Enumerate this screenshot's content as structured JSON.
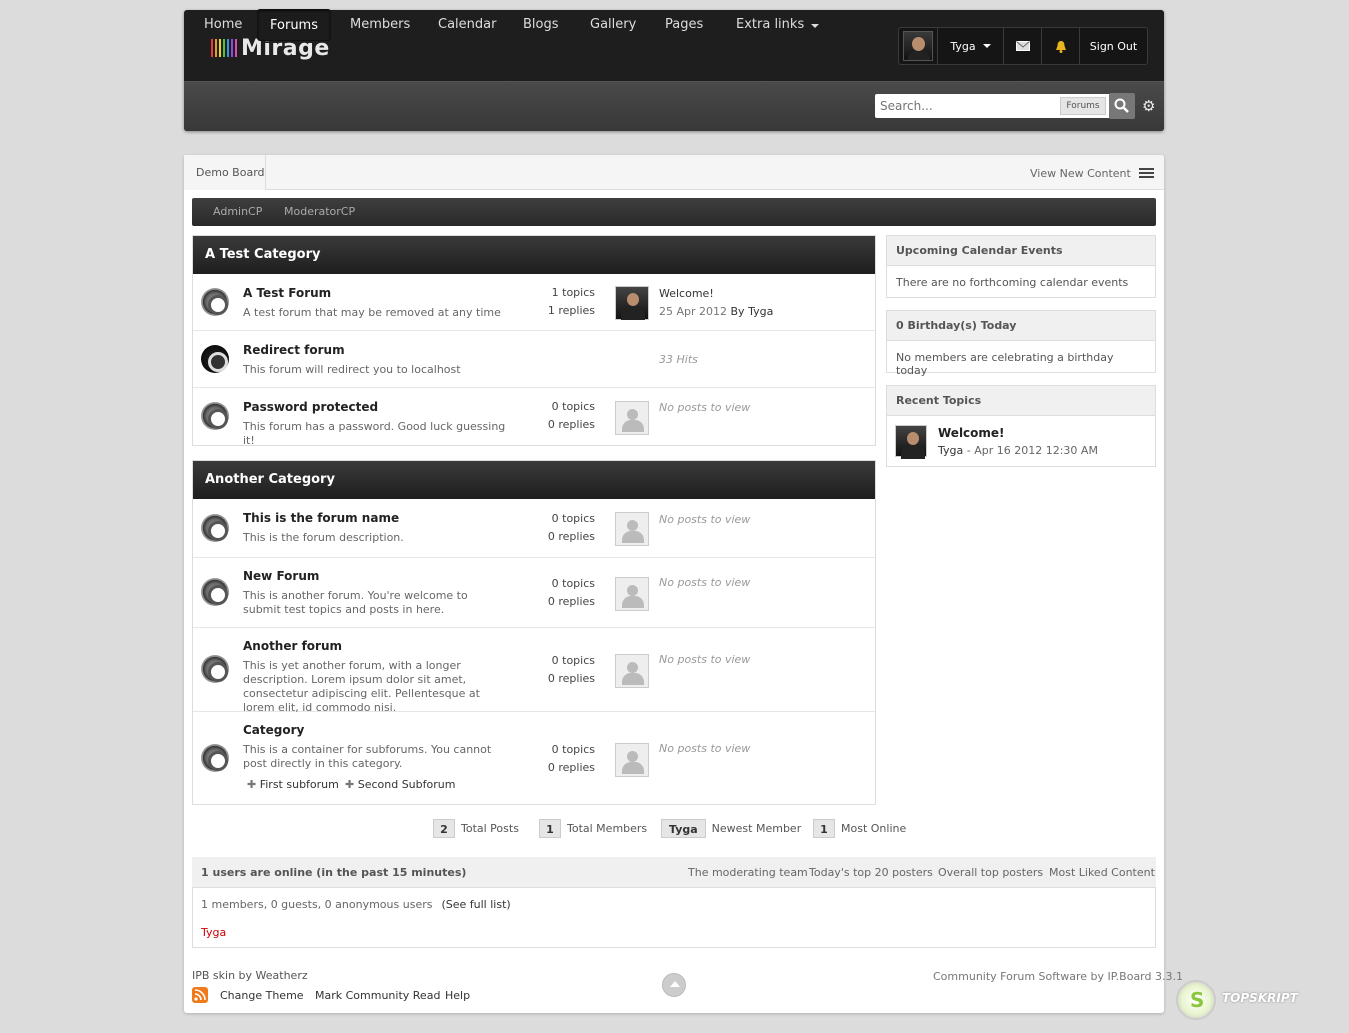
{
  "header": {
    "logo": "Mirage",
    "logo_bar_colors": [
      "#e63b3b",
      "#e89b2b",
      "#e6d82c",
      "#5fbf3a",
      "#3a8fe0",
      "#8a4fd6",
      "#d64fb3"
    ],
    "user_name": "Tyga",
    "sign_out": "Sign Out"
  },
  "nav": {
    "items": [
      "Home",
      "Forums",
      "Members",
      "Calendar",
      "Blogs",
      "Gallery",
      "Pages",
      "Extra links"
    ],
    "active": "Forums",
    "search_placeholder": "Search...",
    "search_scope": "Forums"
  },
  "breadcrumb": {
    "root": "Demo Board",
    "view_new": "View New Content"
  },
  "modbar": {
    "links": [
      "AdminCP",
      "ModeratorCP"
    ]
  },
  "categories": [
    {
      "name": "A Test Category",
      "forums": [
        {
          "title": "A Test Forum",
          "desc": "A test forum that may be removed at any time",
          "topics": "1 topics",
          "replies": "1 replies",
          "last_title": "Welcome!",
          "last_date": "25 Apr 2012",
          "last_by": "By",
          "last_user": "Tyga"
        },
        {
          "title": "Redirect forum",
          "desc": "This forum will redirect you to localhost",
          "hits": "33 Hits"
        },
        {
          "title": "Password protected",
          "desc": "This forum has a password. Good luck guessing it!",
          "topics": "0 topics",
          "replies": "0 replies",
          "no_posts": "No posts to view"
        }
      ]
    },
    {
      "name": "Another Category",
      "forums": [
        {
          "title": "This is the forum name",
          "desc": "This is the forum description.",
          "topics": "0 topics",
          "replies": "0 replies",
          "no_posts": "No posts to view"
        },
        {
          "title": "New Forum",
          "desc": "This is another forum. You're welcome to submit test topics and posts in here.",
          "topics": "0 topics",
          "replies": "0 replies",
          "no_posts": "No posts to view"
        },
        {
          "title": "Another forum",
          "desc": "This is yet another forum, with a longer description. Lorem ipsum dolor sit amet, consectetur adipiscing elit. Pellentesque at lorem elit, id commodo nisi.",
          "topics": "0 topics",
          "replies": "0 replies",
          "no_posts": "No posts to view"
        },
        {
          "title": "Category",
          "desc": "This is a container for subforums. You cannot post directly in this category.",
          "topics": "0 topics",
          "replies": "0 replies",
          "no_posts": "No posts to view",
          "subforums": [
            "First subforum",
            "Second Subforum"
          ]
        }
      ]
    }
  ],
  "sidebar": {
    "calendar": {
      "title": "Upcoming Calendar Events",
      "body": "There are no forthcoming calendar events"
    },
    "birthday": {
      "title": "0 Birthday(s) Today",
      "body": "No members are celebrating a birthday today"
    },
    "recent": {
      "title": "Recent Topics",
      "topic": "Welcome!",
      "user": "Tyga",
      "date": "- Apr 16 2012 12:30 AM"
    }
  },
  "stats": [
    {
      "value": "2",
      "label": "Total Posts"
    },
    {
      "value": "1",
      "label": "Total Members"
    },
    {
      "value": "Tyga",
      "label": "Newest Member"
    },
    {
      "value": "1",
      "label": "Most Online"
    }
  ],
  "online": {
    "title": "1 users are online (in the past 15 minutes)",
    "links": [
      "The moderating team",
      "Today's top 20 posters",
      "Overall top posters",
      "Most Liked Content"
    ],
    "summary": "1 members, 0 guests, 0 anonymous users",
    "full_list": "(See full list)",
    "user": "Tyga",
    "user_color": "#cc0000"
  },
  "footer": {
    "skin": "IPB skin by Weatherz",
    "links": [
      "Change Theme",
      "Mark Community Read",
      "Help"
    ],
    "copyright": "Community Forum Software by IP.Board 3.3.1"
  },
  "watermark": {
    "text": "TOPSKRIPT"
  }
}
